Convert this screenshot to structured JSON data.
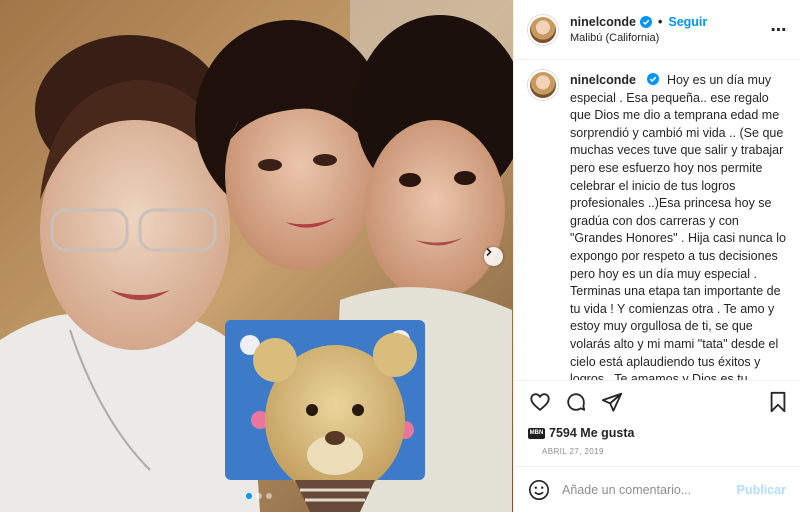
{
  "post": {
    "username": "ninelconde",
    "follow_label": "Seguir",
    "location": "Malibú (California)",
    "caption": "Hoy es un día muy especial . Esa pequeña.. ese regalo que Dios me dio a temprana edad me sorprendió y cambió mi vida .. (Se que muchas veces tuve que salir y trabajar pero ese esfuerzo hoy nos permite celebrar el inicio de tus logros profesionales ..)Esa princesa hoy se gradúa con dos carreras y con \"Grandes Honores\" . Hija casi nunca lo expongo por respeto a tus decisiones pero hoy es un día muy especial . Terminas una etapa tan importante de tu vida ! Y comienzas otra . Te amo y estoy muy orgullosa de ti, se que volarás alto y mi mami \"tata\" desde el cielo está aplaudiendo tus éxitos y logros . Te amamos y Dios es tu proveedor y el té seguirá consintiendo. Te amo mamita. You",
    "likes": "7594 Me gusta",
    "likes_avatar_text": "MBN",
    "date": "ABRIL 27, 2019"
  },
  "comment": {
    "placeholder": "Añade un comentario...",
    "publish_label": "Publicar"
  },
  "icons": {
    "verified": "verified-badge-icon",
    "more": "more-options-icon",
    "like": "heart-icon",
    "comment": "comment-icon",
    "share": "share-icon",
    "save": "bookmark-icon",
    "emoji": "emoji-icon",
    "next": "chevron-right-icon"
  },
  "colors": {
    "accent": "#0095f6",
    "publish_disabled": "#b2dffc",
    "muted": "#8e8e8e"
  },
  "carousel": {
    "count": 3,
    "active": 0
  }
}
